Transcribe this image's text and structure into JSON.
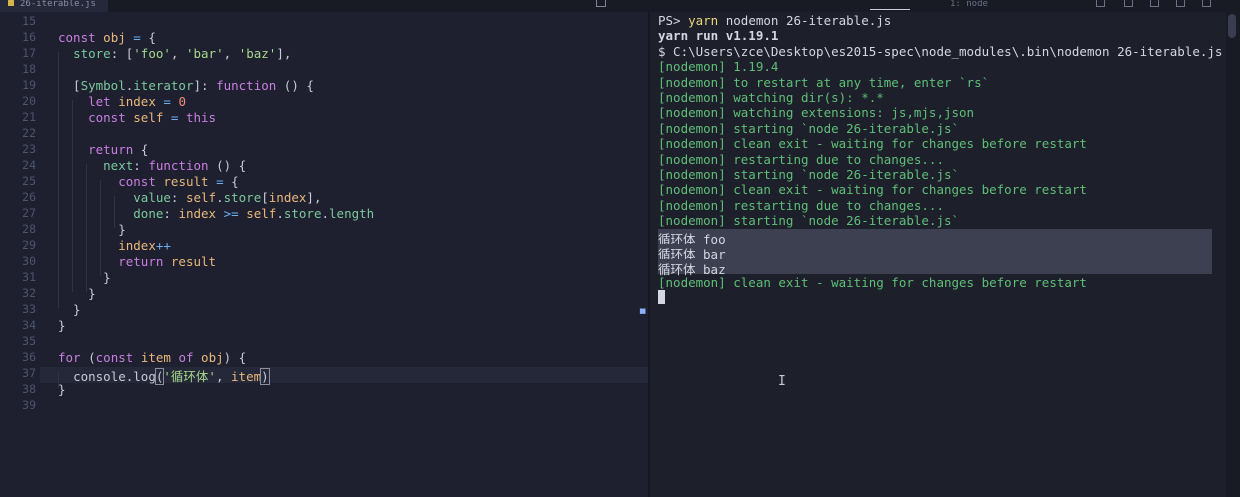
{
  "editor": {
    "tab_label": "26-iterable.js",
    "lines": [
      {
        "n": "15",
        "text": ""
      },
      {
        "n": "16",
        "text": "const obj = {"
      },
      {
        "n": "17",
        "text": "  store: ['foo', 'bar', 'baz'],"
      },
      {
        "n": "18",
        "text": ""
      },
      {
        "n": "19",
        "text": "  [Symbol.iterator]: function () {"
      },
      {
        "n": "20",
        "text": "    let index = 0"
      },
      {
        "n": "21",
        "text": "    const self = this"
      },
      {
        "n": "22",
        "text": ""
      },
      {
        "n": "23",
        "text": "    return {"
      },
      {
        "n": "24",
        "text": "      next: function () {"
      },
      {
        "n": "25",
        "text": "        const result = {"
      },
      {
        "n": "26",
        "text": "          value: self.store[index],"
      },
      {
        "n": "27",
        "text": "          done: index >= self.store.length"
      },
      {
        "n": "28",
        "text": "        }"
      },
      {
        "n": "29",
        "text": "        index++"
      },
      {
        "n": "30",
        "text": "        return result"
      },
      {
        "n": "31",
        "text": "      }"
      },
      {
        "n": "32",
        "text": "    }"
      },
      {
        "n": "33",
        "text": "  }"
      },
      {
        "n": "34",
        "text": "}"
      },
      {
        "n": "35",
        "text": ""
      },
      {
        "n": "36",
        "text": "for (const item of obj) {"
      },
      {
        "n": "37",
        "text": "  console.log('循环体', item)"
      },
      {
        "n": "38",
        "text": "}"
      },
      {
        "n": "39",
        "text": ""
      }
    ],
    "current_line": "37"
  },
  "terminal": {
    "tab_active": "1: node",
    "lines": [
      {
        "text": "PS> yarn nodemon 26-iterable.js",
        "style": "cmd"
      },
      {
        "text": "yarn run v1.19.1",
        "style": "bold"
      },
      {
        "text": "$ C:\\Users\\zce\\Desktop\\es2015-spec\\node_modules\\.bin\\nodemon 26-iterable.js",
        "style": "plain"
      },
      {
        "text": "[nodemon] 1.19.4",
        "style": "green"
      },
      {
        "text": "[nodemon] to restart at any time, enter `rs`",
        "style": "green"
      },
      {
        "text": "[nodemon] watching dir(s): *.*",
        "style": "green"
      },
      {
        "text": "[nodemon] watching extensions: js,mjs,json",
        "style": "green"
      },
      {
        "text": "[nodemon] starting `node 26-iterable.js`",
        "style": "green"
      },
      {
        "text": "[nodemon] clean exit - waiting for changes before restart",
        "style": "green"
      },
      {
        "text": "[nodemon] restarting due to changes...",
        "style": "green"
      },
      {
        "text": "[nodemon] starting `node 26-iterable.js`",
        "style": "green"
      },
      {
        "text": "[nodemon] clean exit - waiting for changes before restart",
        "style": "green"
      },
      {
        "text": "[nodemon] restarting due to changes...",
        "style": "green"
      },
      {
        "text": "[nodemon] starting `node 26-iterable.js`",
        "style": "green"
      },
      {
        "text": "循环体 foo",
        "style": "selected"
      },
      {
        "text": "循环体 bar",
        "style": "selected"
      },
      {
        "text": "循环体 baz",
        "style": "selected"
      },
      {
        "text": "[nodemon] clean exit - waiting for changes before restart",
        "style": "green"
      }
    ]
  },
  "colors": {
    "keyword": "#c77fdf",
    "variable": "#e8b87a",
    "property": "#7bc99b",
    "string": "#a6d88b",
    "number": "#f08f7a",
    "operator": "#6ab0f0",
    "nodemon_green": "#5fbf77",
    "selection": "#3d4051"
  }
}
